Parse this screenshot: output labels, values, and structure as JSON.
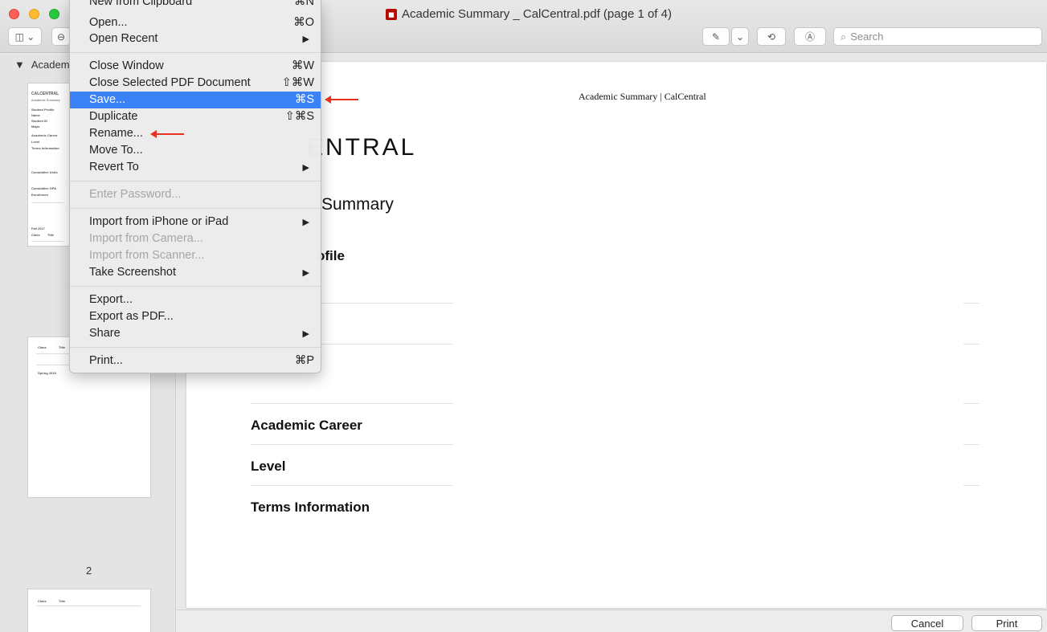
{
  "window": {
    "title": "Academic Summary _ CalCentral.pdf (page 1 of 4)"
  },
  "toolbar": {
    "search_placeholder": "Search",
    "sidebar_toggle_icon": "sidebar-icon",
    "markup_icon": "pen-icon",
    "rotate_icon": "rotate-icon",
    "annotate_icon": "markup-circle-icon"
  },
  "sidebar": {
    "header": "Academ",
    "page_number": "2",
    "thumb1": {
      "brand": "CALCENTRAL",
      "title": "Academic Summary",
      "rows": [
        "Student Profile",
        "Name",
        "Student ID",
        "Major",
        "Academic Career",
        "Level",
        "Terms Information",
        "Cumulative Units",
        "Cumulative GPA",
        "Enrollment",
        "Fall 2017",
        "Class",
        "Title"
      ]
    },
    "thumb2": {
      "rows": [
        "Class",
        "Title",
        "Spring 2018"
      ]
    },
    "thumb3": {
      "rows": [
        "Class",
        "Title"
      ]
    }
  },
  "document": {
    "header": "Academic Summary | CalCentral",
    "logo": "ENTRAL",
    "summary": "Summary",
    "profile": "ofile",
    "labels": {
      "academic_career": "Academic Career",
      "level": "Level",
      "terms_information": "Terms Information"
    }
  },
  "menu": {
    "items": [
      {
        "label": "New from Clipboard",
        "shortcut": "⌘N"
      },
      {
        "label": "Open...",
        "shortcut": "⌘O"
      },
      {
        "label": "Open Recent",
        "shortcut": "▶"
      },
      {
        "label": "Close Window",
        "shortcut": "⌘W"
      },
      {
        "label": "Close Selected PDF Document",
        "shortcut": "⇧⌘W"
      },
      {
        "label": "Save...",
        "shortcut": "⌘S"
      },
      {
        "label": "Duplicate",
        "shortcut": "⇧⌘S"
      },
      {
        "label": "Rename...",
        "shortcut": ""
      },
      {
        "label": "Move To...",
        "shortcut": ""
      },
      {
        "label": "Revert To",
        "shortcut": "▶"
      },
      {
        "label": "Enter Password...",
        "shortcut": ""
      },
      {
        "label": "Import from iPhone or iPad",
        "shortcut": "▶"
      },
      {
        "label": "Import from Camera...",
        "shortcut": ""
      },
      {
        "label": "Import from Scanner...",
        "shortcut": ""
      },
      {
        "label": "Take Screenshot",
        "shortcut": "▶"
      },
      {
        "label": "Export...",
        "shortcut": ""
      },
      {
        "label": "Export as PDF...",
        "shortcut": ""
      },
      {
        "label": "Share",
        "shortcut": "▶"
      },
      {
        "label": "Print...",
        "shortcut": "⌘P"
      }
    ]
  },
  "dialog": {
    "cancel": "Cancel",
    "print": "Print"
  },
  "colors": {
    "accent": "#3a82f6",
    "annotation_arrow": "#e8321f"
  }
}
